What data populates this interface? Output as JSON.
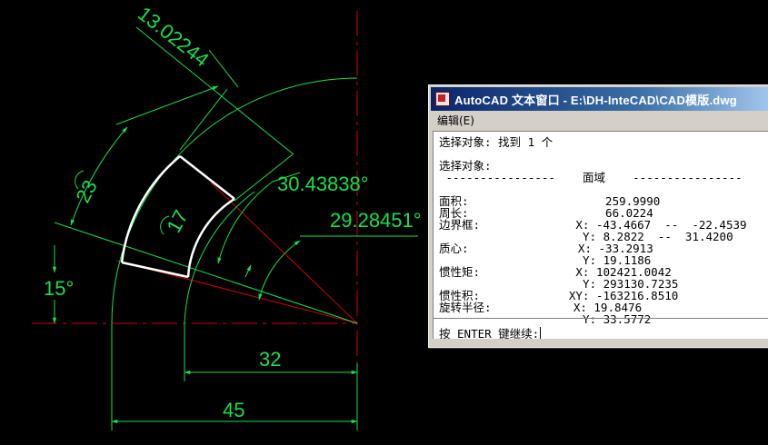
{
  "drawing": {
    "dim_arc_length": "13.02244",
    "dim_angle_1": "30.43838°",
    "dim_angle_2": "29.28451°",
    "dim_radius_23": "23",
    "dim_radius_17": "17",
    "dim_angle_15": "15°",
    "dim_32": "32",
    "dim_45": "45"
  },
  "text_window": {
    "title": "AutoCAD 文本窗口 - E:\\DH-InteCAD\\CAD模版.dwg",
    "menu": {
      "edit": "编辑(E)"
    },
    "lines": [
      "选择对象: 找到 1 个",
      "",
      "选择对象:",
      " ----------------    面域    ----------------",
      "",
      "面积:                    259.9990",
      "周长:                    66.0224",
      "边界框:              X: -43.4667  --  -22.4539",
      "                     Y: 8.2822  --  31.4200",
      "质心:                X: -33.2913",
      "                     Y: 19.1186",
      "惯性矩:              X: 102421.0042",
      "                     Y: 293130.7235",
      "惯性积:             XY: -163216.8510",
      "旋转半径:            X: 19.8476",
      "                     Y: 33.5772"
    ],
    "prompt": "按 ENTER 键继续:"
  }
}
